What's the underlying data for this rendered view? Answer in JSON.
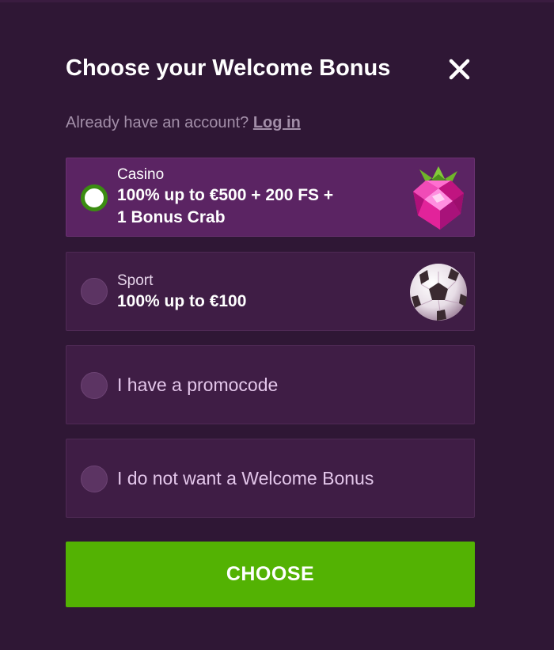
{
  "dialog": {
    "title": "Choose your Welcome Bonus",
    "account_prompt": "Already have an account?",
    "login_label": "Log in"
  },
  "options": [
    {
      "label": "Casino",
      "value_line1": "100% up to €500 + 200 FS +",
      "value_line2": "1 Bonus Crab",
      "icon": "raspberry-icon",
      "selected": true
    },
    {
      "label": "Sport",
      "value_line1": "100% up to €100",
      "icon": "soccer-ball-icon",
      "selected": false
    },
    {
      "label": "I have a promocode",
      "selected": false
    },
    {
      "label": "I do not want a Welcome Bonus",
      "selected": false
    }
  ],
  "action": {
    "choose_label": "CHOOSE"
  },
  "colors": {
    "background": "#2f1735",
    "option_bg": "#3f1d45",
    "option_selected_bg": "#5b2463",
    "radio_selected": "#3b8c12",
    "button": "#53b203"
  }
}
